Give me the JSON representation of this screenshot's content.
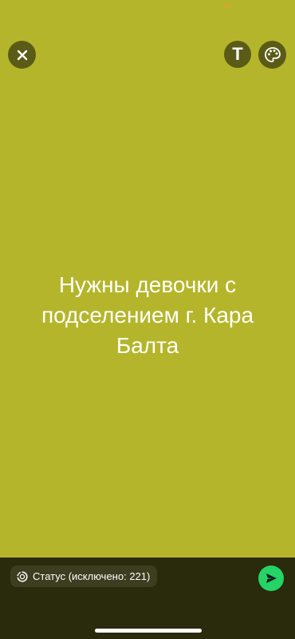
{
  "status": {
    "text": "Нужны девочки с\nподселением г. Кара\nБалта",
    "background_color": "#b5b52b"
  },
  "toolbar": {
    "close_icon": "close-icon",
    "text_tool_label": "T",
    "palette_icon": "palette-icon"
  },
  "bottom": {
    "privacy_label": "Статус (исключено: 221)",
    "privacy_icon": "status-ring-icon",
    "send_icon": "send-icon",
    "send_color": "#25d366"
  }
}
